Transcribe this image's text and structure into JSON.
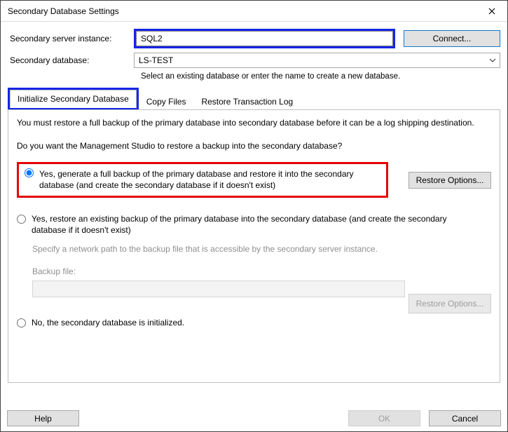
{
  "window": {
    "title": "Secondary Database Settings"
  },
  "labels": {
    "server_instance": "Secondary server instance:",
    "database": "Secondary database:"
  },
  "fields": {
    "server_instance": "SQL2",
    "database": "LS-TEST",
    "hint": "Select an existing database or enter the name to create a new database."
  },
  "buttons": {
    "connect": "Connect...",
    "restore_options": "Restore Options...",
    "restore_options_disabled": "Restore Options...",
    "help": "Help",
    "ok": "OK",
    "cancel": "Cancel"
  },
  "tabs": {
    "init": "Initialize Secondary Database",
    "copy": "Copy Files",
    "restore": "Restore Transaction Log"
  },
  "panel": {
    "intro": "You must restore a full backup of the primary database into secondary database before it can be a log shipping destination.",
    "question": "Do you want the Management Studio to restore a backup into the secondary database?",
    "opt1": "Yes, generate a full backup of the primary database and restore it into the secondary database (and create the secondary database if it doesn't exist)",
    "opt2": "Yes, restore an existing backup of the primary database into the secondary database (and create the secondary database if it doesn't exist)",
    "opt3": "No, the secondary database is initialized.",
    "sub_hint": "Specify a network path to the backup file that is accessible by the secondary server instance.",
    "backup_file_label": "Backup file:"
  }
}
